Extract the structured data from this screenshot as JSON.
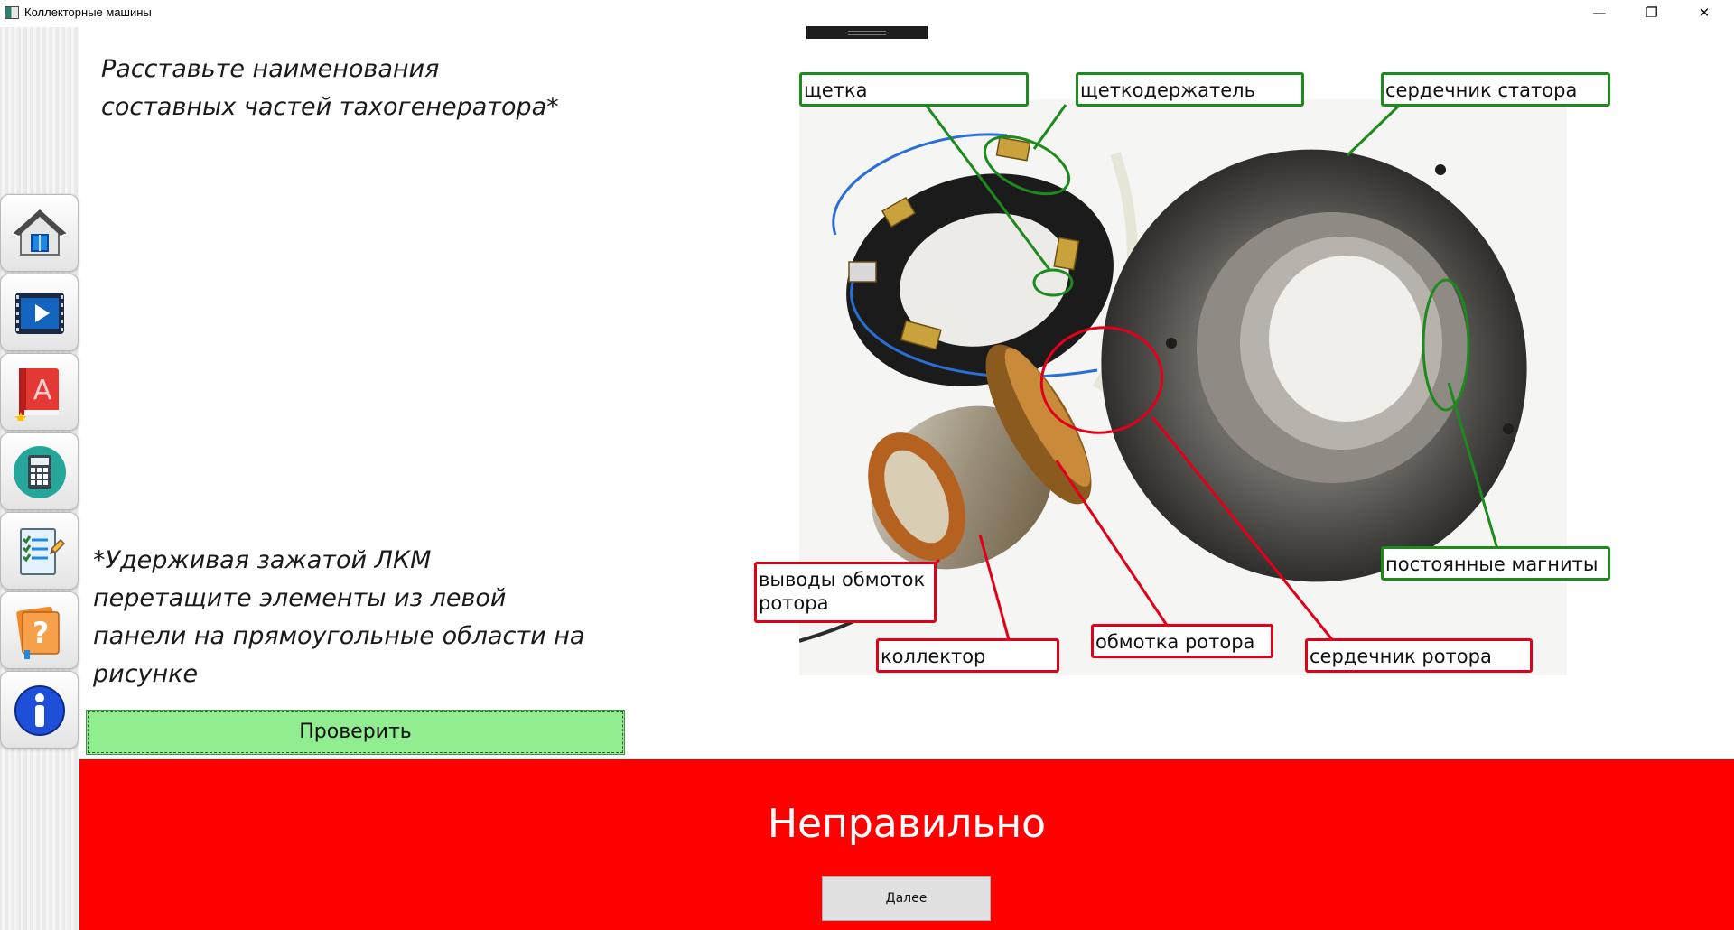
{
  "window": {
    "title": "Коллекторные машины",
    "minimize": "—",
    "maximize": "❐",
    "close": "✕"
  },
  "sidebar": {
    "items": [
      {
        "name": "home",
        "icon": "home-icon"
      },
      {
        "name": "video",
        "icon": "video-icon"
      },
      {
        "name": "textbook",
        "icon": "book-icon"
      },
      {
        "name": "calculator",
        "icon": "calculator-icon"
      },
      {
        "name": "test",
        "icon": "checklist-icon"
      },
      {
        "name": "help",
        "icon": "question-book-icon"
      },
      {
        "name": "info",
        "icon": "info-icon"
      }
    ]
  },
  "instructions": {
    "top": "Расставьте наименования\nсоставных частей тахогенератора*",
    "bottom": "*Удерживая зажатой ЛКМ\nперетащите элементы из левой\nпанели на прямоугольные области на\nрисунке"
  },
  "check_button": "Проверить",
  "labels": {
    "brush": "щетка",
    "brush_holder": "щеткодержатель",
    "stator_core": "сердечник статора",
    "permanent_magnets": "постоянные магниты",
    "winding_leads": "выводы обмоток\nротора",
    "commutator": "коллектор",
    "rotor_winding": "обмотка ротора",
    "rotor_core": "сердечник ротора"
  },
  "colors": {
    "correct_outline": "#1c8a1c",
    "incorrect_outline": "#e0001a",
    "check_button": "#90ee90",
    "result_background": "#ff0000"
  },
  "result": {
    "text": "Неправильно",
    "next_button": "Далее"
  }
}
